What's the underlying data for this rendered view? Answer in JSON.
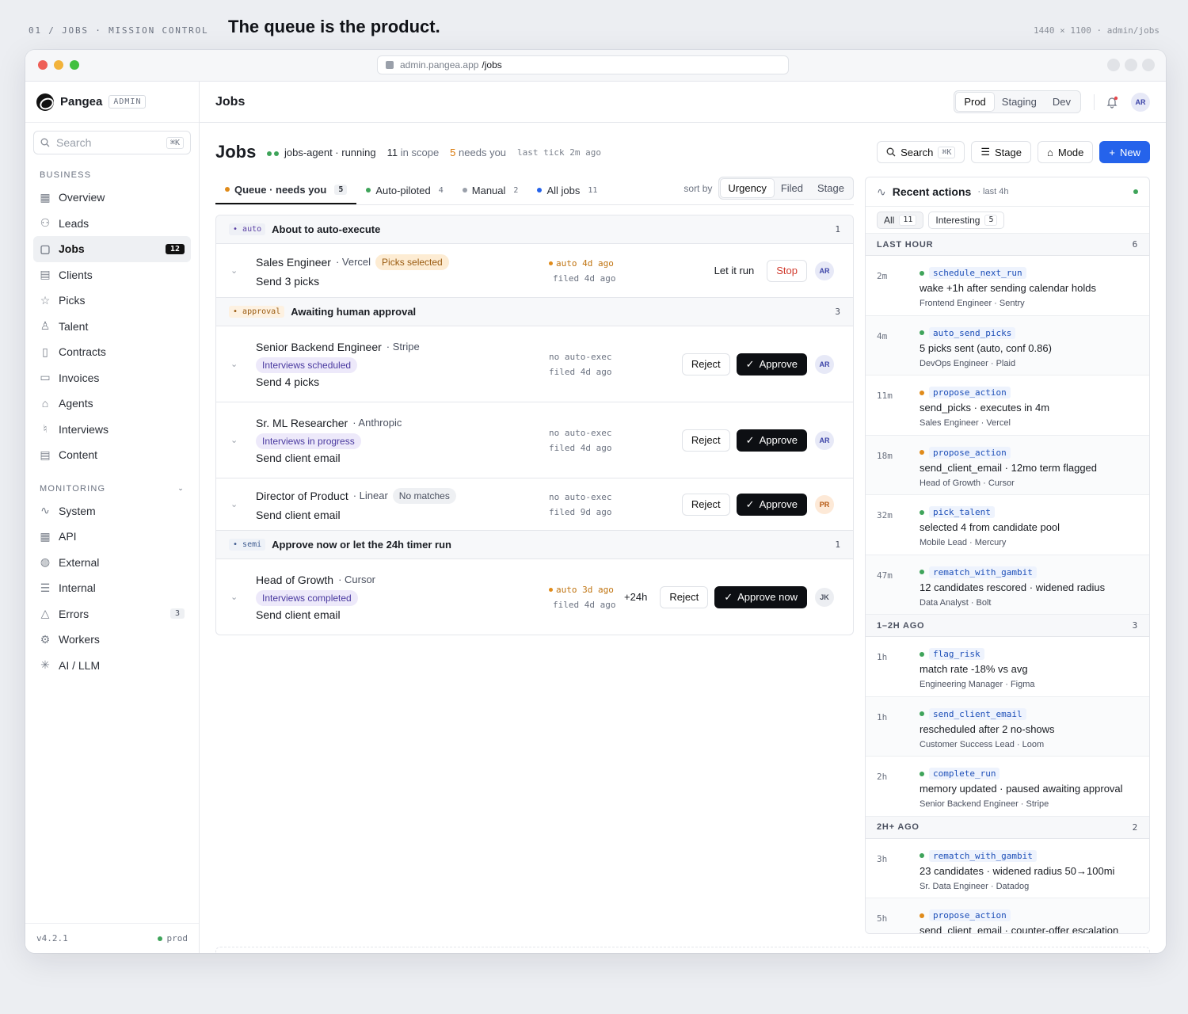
{
  "caption": {
    "left": "01 / JOBS · MISSION CONTROL",
    "title": "The queue is the product.",
    "right": "1440 × 1100 · admin/jobs"
  },
  "browser": {
    "url_host": "admin.pangea.app",
    "url_path": "/jobs",
    "traffic_lights": [
      "#ee5f57",
      "#f2b33b",
      "#42c040"
    ]
  },
  "sidebar": {
    "brand": "Pangea",
    "admin_tag": "ADMIN",
    "search_placeholder": "Search",
    "search_kbd": "⌘K",
    "business_label": "BUSINESS",
    "business_items": [
      {
        "label": "Overview",
        "icon": "grid-icon"
      },
      {
        "label": "Leads",
        "icon": "user-plus-icon"
      },
      {
        "label": "Jobs",
        "icon": "briefcase-icon",
        "count": "12"
      },
      {
        "label": "Clients",
        "icon": "document-icon"
      },
      {
        "label": "Picks",
        "icon": "star-icon"
      },
      {
        "label": "Talent",
        "icon": "person-icon"
      },
      {
        "label": "Contracts",
        "icon": "contract-icon"
      },
      {
        "label": "Invoices",
        "icon": "invoice-icon"
      },
      {
        "label": "Agents",
        "icon": "bot-icon"
      },
      {
        "label": "Interviews",
        "icon": "mic-icon"
      },
      {
        "label": "Content",
        "icon": "page-icon"
      }
    ],
    "monitoring_label": "MONITORING",
    "monitoring_items": [
      {
        "label": "System",
        "icon": "pulse-icon"
      },
      {
        "label": "API",
        "icon": "grid-icon"
      },
      {
        "label": "External",
        "icon": "globe-icon"
      },
      {
        "label": "Internal",
        "icon": "server-icon"
      },
      {
        "label": "Errors",
        "icon": "warning-icon",
        "count": "3"
      },
      {
        "label": "Workers",
        "icon": "cog-icon"
      },
      {
        "label": "AI / LLM",
        "icon": "sparkle-icon"
      }
    ],
    "version": "v4.2.1",
    "env": "prod"
  },
  "header": {
    "title": "Jobs",
    "envs": [
      "Prod",
      "Staging",
      "Dev"
    ],
    "active_env": "Prod",
    "user_initials": "AR"
  },
  "page": {
    "title": "Jobs",
    "agent_status": "jobs-agent · running",
    "in_scope_count": "11",
    "in_scope_label": "in scope",
    "needs_you_count": "5",
    "needs_you_label": "needs you",
    "last_tick": "last tick 2m ago",
    "search_label": "Search",
    "search_kbd": "⌘K",
    "stage_label": "Stage",
    "mode_label": "Mode",
    "new_label": "New"
  },
  "tabs": [
    {
      "label": "Queue · needs you",
      "count": "5",
      "color": "#e08b1a"
    },
    {
      "label": "Auto-piloted",
      "count": "4",
      "color": "#3fa45a"
    },
    {
      "label": "Manual",
      "count": "2",
      "color": "#9aa0aa"
    },
    {
      "label": "All jobs",
      "count": "11",
      "color": "#2563eb"
    }
  ],
  "sort": {
    "label": "sort by",
    "options": [
      "Urgency",
      "Filed",
      "Stage"
    ],
    "active": "Urgency"
  },
  "groups": {
    "auto": {
      "tag": "auto",
      "title": "About to auto-execute",
      "count": "1"
    },
    "approval": {
      "tag": "approval",
      "title": "Awaiting human approval",
      "count": "3"
    },
    "semi": {
      "tag": "semi",
      "title": "Approve now or let the 24h timer run",
      "count": "1"
    }
  },
  "jobs": [
    {
      "role": "Sales Engineer",
      "company": "· Vercel",
      "pill": "Picks selected",
      "action": "Send 3 picks",
      "meta1": "auto 4d ago",
      "meta2": "filed 4d ago",
      "btn_a": "Let it run",
      "btn_b": "Stop",
      "avatar": "AR"
    },
    {
      "role": "Senior Backend Engineer",
      "company": "· Stripe",
      "pill": "Interviews scheduled",
      "action": "Send 4 picks",
      "meta1": "no auto-exec",
      "meta2": "filed 4d ago",
      "btn_a": "Reject",
      "btn_b": "Approve",
      "avatar": "AR"
    },
    {
      "role": "Sr. ML Researcher",
      "company": "· Anthropic",
      "pill": "Interviews in progress",
      "action": "Send client email",
      "meta1": "no auto-exec",
      "meta2": "filed 4d ago",
      "btn_a": "Reject",
      "btn_b": "Approve",
      "avatar": "AR"
    },
    {
      "role": "Director of Product",
      "company": "· Linear",
      "pill": "No matches",
      "action": "Send client email",
      "meta1": "no auto-exec",
      "meta2": "filed 9d ago",
      "btn_a": "Reject",
      "btn_b": "Approve",
      "avatar": "PR"
    },
    {
      "role": "Head of Growth",
      "company": "· Cursor",
      "pill": "Interviews completed",
      "action": "Send client email",
      "meta1": "auto 3d ago",
      "meta2": "filed 4d ago",
      "timer": "+24h",
      "btn_a": "Reject",
      "btn_b": "Approve now",
      "avatar": "JK"
    }
  ],
  "recent": {
    "title": "Recent actions",
    "subtitle": "· last 4h",
    "filters": [
      {
        "label": "All",
        "count": "11"
      },
      {
        "label": "Interesting",
        "count": "5"
      }
    ],
    "sections": [
      {
        "label": "LAST HOUR",
        "count": "6"
      },
      {
        "label": "1–2H AGO",
        "count": "3"
      },
      {
        "label": "2H+ AGO",
        "count": "2"
      }
    ],
    "items": [
      {
        "time": "2m",
        "fn": "schedule_next_run",
        "dot": "#3fa45a",
        "desc": "wake +1h after sending calendar holds",
        "src": "Frontend Engineer · Sentry"
      },
      {
        "time": "4m",
        "fn": "auto_send_picks",
        "dot": "#3fa45a",
        "desc": "5 picks sent (auto, conf 0.86)",
        "src": "DevOps Engineer · Plaid"
      },
      {
        "time": "11m",
        "fn": "propose_action",
        "dot": "#e08b1a",
        "desc": "send_picks · executes in 4m",
        "src": "Sales Engineer · Vercel"
      },
      {
        "time": "18m",
        "fn": "propose_action",
        "dot": "#e08b1a",
        "desc": "send_client_email · 12mo term flagged",
        "src": "Head of Growth · Cursor"
      },
      {
        "time": "32m",
        "fn": "pick_talent",
        "dot": "#3fa45a",
        "desc": "selected 4 from candidate pool",
        "src": "Mobile Lead · Mercury"
      },
      {
        "time": "47m",
        "fn": "rematch_with_gambit",
        "dot": "#3fa45a",
        "desc": "12 candidates rescored · widened radius",
        "src": "Data Analyst · Bolt"
      },
      {
        "time": "1h",
        "fn": "flag_risk",
        "dot": "#3fa45a",
        "desc": "match rate -18% vs avg",
        "src": "Engineering Manager · Figma"
      },
      {
        "time": "1h",
        "fn": "send_client_email",
        "dot": "#3fa45a",
        "desc": "rescheduled after 2 no-shows",
        "src": "Customer Success Lead · Loom"
      },
      {
        "time": "2h",
        "fn": "complete_run",
        "dot": "#3fa45a",
        "desc": "memory updated · paused awaiting approval",
        "src": "Senior Backend Engineer · Stripe"
      },
      {
        "time": "3h",
        "fn": "rematch_with_gambit",
        "dot": "#3fa45a",
        "desc": "23 candidates · widened radius 50→100mi",
        "src": "Sr. Data Engineer · Datadog"
      },
      {
        "time": "5h",
        "fn": "propose_action",
        "dot": "#e08b1a",
        "desc": "send_client_email · counter-offer escalation",
        "src": ""
      }
    ]
  }
}
